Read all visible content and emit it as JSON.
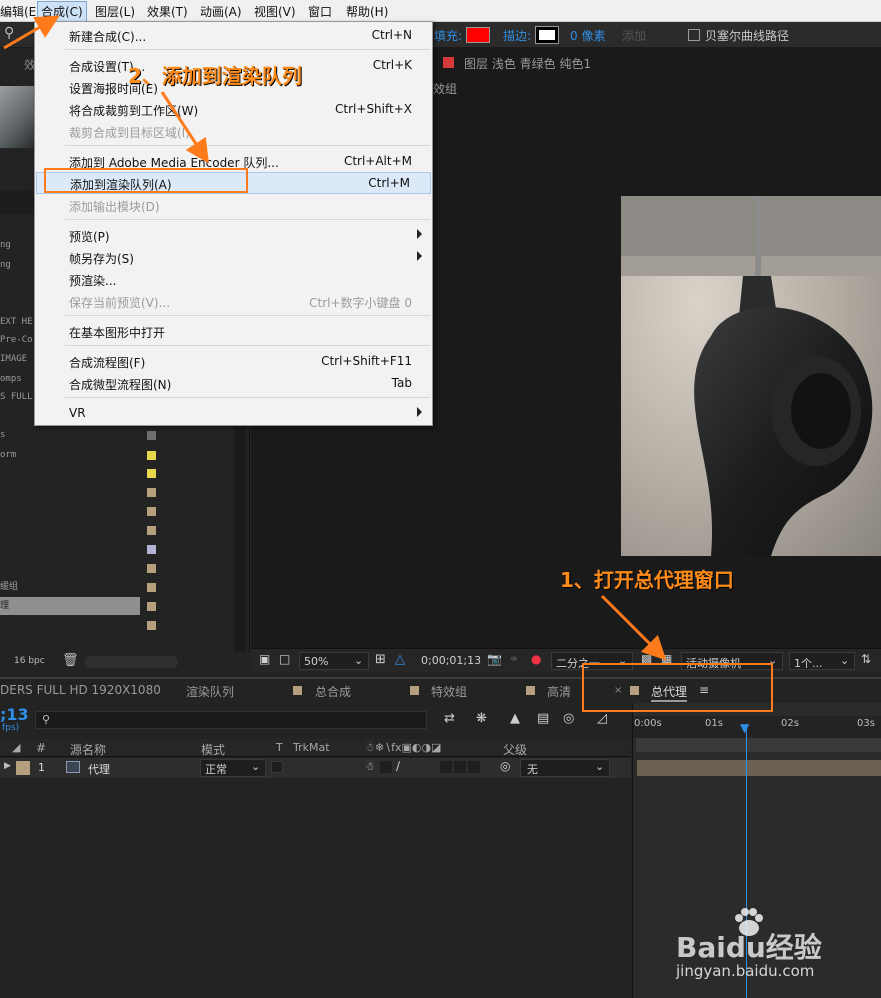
{
  "menubar": {
    "items": [
      {
        "label": "编辑(E)"
      },
      {
        "label": "合成(C)"
      },
      {
        "label": "图层(L)"
      },
      {
        "label": "效果(T)"
      },
      {
        "label": "动画(A)"
      },
      {
        "label": "视图(V)"
      },
      {
        "label": "窗口"
      },
      {
        "label": "帮助(H)"
      }
    ]
  },
  "toolbar": {
    "fill_label": "填充:",
    "stroke_label": "描边:",
    "stroke_value": "0 像素",
    "add_label": "添加",
    "bezier_label": "贝塞尔曲线路径",
    "fill_color": "#ff0000"
  },
  "composition_menu": {
    "items": [
      {
        "label": "新建合成(C)...",
        "shortcut": "Ctrl+N"
      },
      {
        "label": "合成设置(T)...",
        "shortcut": "Ctrl+K"
      },
      {
        "label": "设置海报时间(E)",
        "shortcut": ""
      },
      {
        "label": "将合成裁剪到工作区(W)",
        "shortcut": "Ctrl+Shift+X"
      },
      {
        "label": "裁剪合成到目标区域(I)",
        "shortcut": ""
      },
      {
        "label": "添加到 Adobe Media Encoder 队列...",
        "shortcut": "Ctrl+Alt+M"
      },
      {
        "label": "添加到渲染队列(A)",
        "shortcut": "Ctrl+M"
      },
      {
        "label": "添加输出模块(D)",
        "shortcut": ""
      },
      {
        "label": "预览(P)",
        "shortcut": ""
      },
      {
        "label": "帧另存为(S)",
        "shortcut": ""
      },
      {
        "label": "预渲染...",
        "shortcut": ""
      },
      {
        "label": "保存当前预览(V)...",
        "shortcut": "Ctrl+数字小键盘 0"
      },
      {
        "label": "在基本图形中打开",
        "shortcut": ""
      },
      {
        "label": "合成流程图(F)",
        "shortcut": "Ctrl+Shift+F11"
      },
      {
        "label": "合成微型流程图(N)",
        "shortcut": "Tab"
      },
      {
        "label": "VR",
        "shortcut": ""
      }
    ]
  },
  "viewer": {
    "layer_tab": "图层 浅色 青绿色 纯色1",
    "sub_tab": "效组",
    "zoom": "50%",
    "timecode": "0;00;01;13",
    "resolution": "二分之一",
    "camera": "活动摄像机",
    "views": "1个..."
  },
  "project": {
    "rows": [
      "ng",
      "ng",
      "EXT HE",
      "Pre-Co",
      "IMAGE",
      "omps",
      "S FULL",
      "s",
      "orm",
      "",
      "",
      "",
      "",
      "",
      "",
      "",
      "缓组",
      "理",
      ""
    ],
    "bpc": "16 bpc"
  },
  "timeline": {
    "tabs": [
      {
        "label": "DERS FULL HD 1920X1080"
      },
      {
        "label": "渲染队列"
      },
      {
        "label": "总合成"
      },
      {
        "label": "特效组"
      },
      {
        "label": "高清"
      },
      {
        "label": "总代理"
      }
    ],
    "time_display": ";13",
    "fps": "fps)",
    "columns": {
      "source_name": "源名称",
      "mode": "模式",
      "t": "T",
      "trkmat": "TrkMat",
      "parent": "父级"
    },
    "layer": {
      "number": "1",
      "name": "代理",
      "mode": "正常",
      "parent": "无"
    },
    "ruler": [
      "0:00s",
      "01s",
      "02s",
      "03s"
    ]
  },
  "annotations": {
    "step1": "1、打开总代理窗口",
    "step2": "2、添加到渲染队列"
  },
  "watermark": {
    "brand": "Baidu经验",
    "url": "jingyan.baidu.com"
  }
}
